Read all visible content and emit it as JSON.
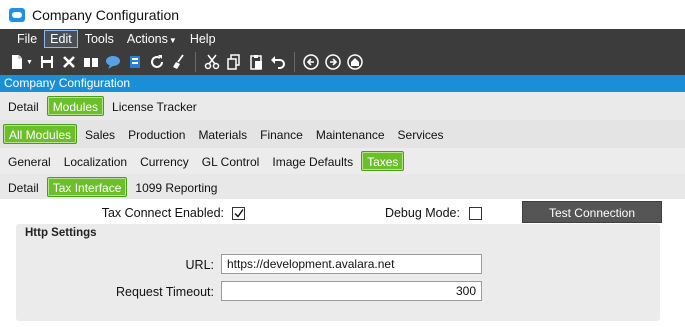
{
  "window": {
    "title": "Company Configuration"
  },
  "menu": {
    "items": [
      "File",
      "Edit",
      "Tools",
      "Actions",
      "Help"
    ],
    "active": "Edit"
  },
  "toolbar": {
    "icons": [
      "new-icon",
      "save-icon",
      "delete-icon",
      "book-icon",
      "comment-icon",
      "notes-icon",
      "refresh-icon",
      "clear-icon",
      "cut-icon",
      "copy-icon",
      "paste-icon",
      "undo-icon",
      "previous-icon",
      "next-icon",
      "home-icon"
    ]
  },
  "header": {
    "title": "Company Configuration"
  },
  "tabs": {
    "row1": [
      "Detail",
      "Modules",
      "License Tracker"
    ],
    "row2": [
      "All Modules",
      "Sales",
      "Production",
      "Materials",
      "Finance",
      "Maintenance",
      "Services"
    ],
    "row3": [
      "General",
      "Localization",
      "Currency",
      "GL Control",
      "Image Defaults",
      "Taxes"
    ],
    "row4": [
      "Detail",
      "Tax Interface",
      "1099 Reporting"
    ],
    "selected": {
      "row1": "Modules",
      "row2": "All Modules",
      "row3": "Taxes",
      "row4": "Tax Interface"
    }
  },
  "form": {
    "tax_connect_label": "Tax Connect Enabled:",
    "tax_connect_checked": true,
    "debug_mode_label": "Debug Mode:",
    "debug_mode_checked": false,
    "test_connection_label": "Test Connection",
    "http_group_title": "Http Settings",
    "url_label": "URL:",
    "url_value": "https://development.avalara.net",
    "timeout_label": "Request Timeout:",
    "timeout_value": "300"
  },
  "colors": {
    "accent_green": "#6abf2b",
    "header_blue": "#1a8fd8",
    "menu_dark": "#3c3c3c"
  }
}
